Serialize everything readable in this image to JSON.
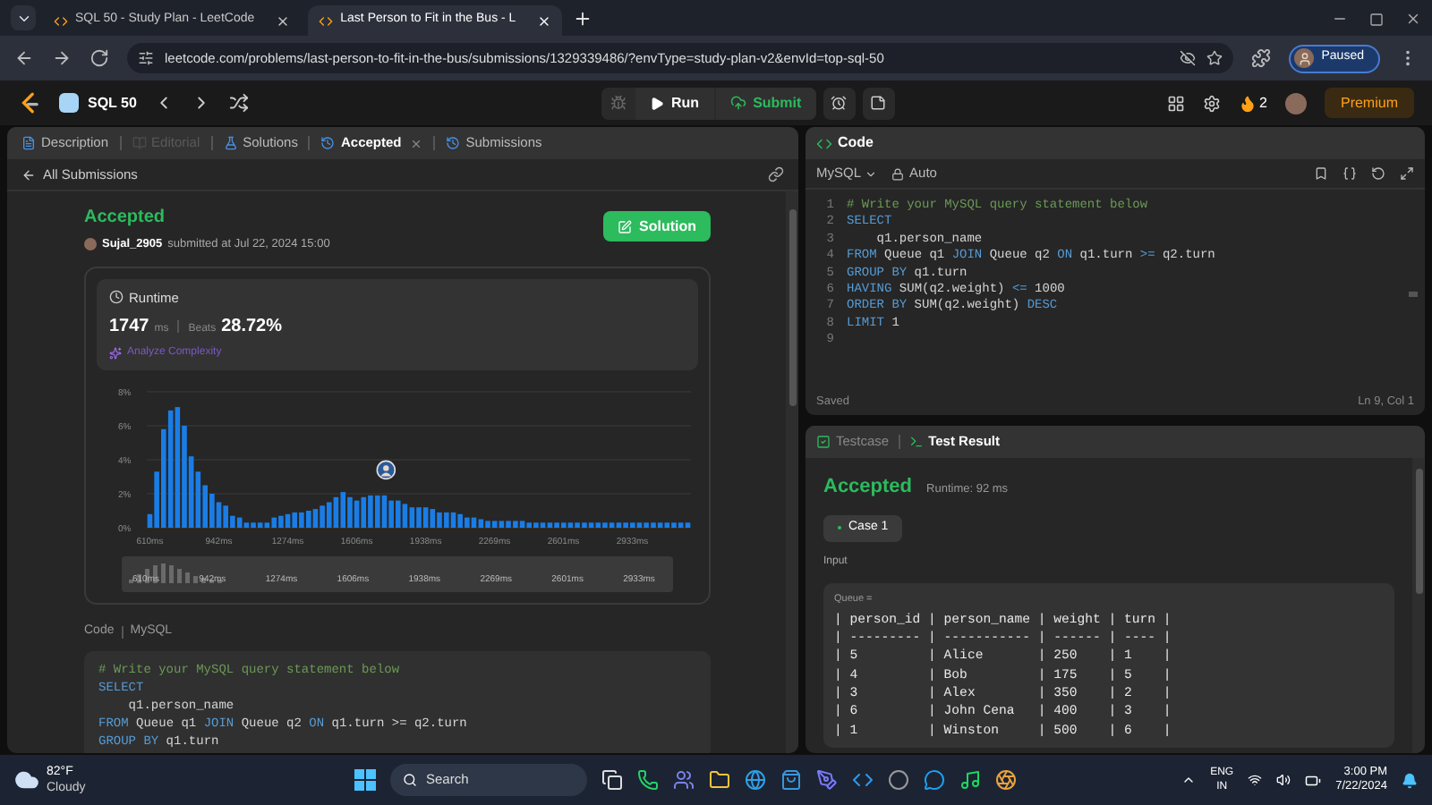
{
  "browser": {
    "tabs": [
      {
        "title": "SQL 50 - Study Plan - LeetCode",
        "selected": false
      },
      {
        "title": "Last Person to Fit in the Bus - L",
        "selected": true
      }
    ],
    "url": "leetcode.com/problems/last-person-to-fit-in-the-bus/submissions/1329339486/?envType=study-plan-v2&envId=top-sql-50",
    "profile": "Paused"
  },
  "nav": {
    "study_plan": "SQL 50",
    "run": "Run",
    "submit": "Submit",
    "streak": "2",
    "premium": "Premium"
  },
  "left_tabs": [
    {
      "label": "Description",
      "selected": false,
      "disabled": false,
      "closable": false
    },
    {
      "label": "Editorial",
      "selected": false,
      "disabled": true,
      "closable": false
    },
    {
      "label": "Solutions",
      "selected": false,
      "disabled": false,
      "closable": false
    },
    {
      "label": "Accepted",
      "selected": true,
      "disabled": false,
      "closable": true
    },
    {
      "label": "Submissions",
      "selected": false,
      "disabled": false,
      "closable": false
    }
  ],
  "back_link": "All Submissions",
  "submission": {
    "status": "Accepted",
    "user": "Sujal_2905",
    "submitted": "submitted at Jul 22, 2024 15:00",
    "solution_button": "Solution",
    "runtime_label": "Runtime",
    "runtime": "1747",
    "runtime_unit": "ms",
    "beats_label": "Beats",
    "beats": "28.72%",
    "analyze": "Analyze Complexity",
    "chart_data": {
      "type": "bar",
      "grid": true,
      "xlim": [
        595,
        3215
      ],
      "ylim": [
        0,
        8
      ],
      "x": [
        610,
        643,
        676,
        710,
        743,
        776,
        809,
        842,
        876,
        909,
        942,
        975,
        1008,
        1042,
        1075,
        1108,
        1141,
        1174,
        1208,
        1241,
        1274,
        1307,
        1340,
        1374,
        1407,
        1440,
        1473,
        1506,
        1540,
        1573,
        1606,
        1639,
        1672,
        1706,
        1739,
        1772,
        1805,
        1838,
        1872,
        1905,
        1938,
        1971,
        2004,
        2038,
        2071,
        2104,
        2137,
        2170,
        2204,
        2237,
        2270,
        2303,
        2336,
        2370,
        2403,
        2436,
        2469,
        2502,
        2536,
        2569,
        2602,
        2635,
        2668,
        2702,
        2735,
        2768,
        2801,
        2834,
        2868,
        2901,
        2934,
        2967,
        3000,
        3034,
        3067,
        3100,
        3133,
        3166,
        3200
      ],
      "values": [
        0.8,
        3.3,
        5.8,
        6.9,
        7.1,
        6.0,
        4.2,
        3.3,
        2.5,
        2.0,
        1.5,
        1.3,
        0.7,
        0.6,
        0.3,
        0.3,
        0.3,
        0.3,
        0.6,
        0.7,
        0.8,
        0.9,
        0.9,
        1.0,
        1.1,
        1.3,
        1.5,
        1.8,
        2.1,
        1.8,
        1.6,
        1.8,
        1.9,
        1.9,
        1.9,
        1.6,
        1.6,
        1.4,
        1.2,
        1.2,
        1.2,
        1.1,
        0.9,
        0.9,
        0.9,
        0.8,
        0.6,
        0.6,
        0.5,
        0.4,
        0.4,
        0.4,
        0.4,
        0.4,
        0.4,
        0.3,
        0.3,
        0.3,
        0.3,
        0.3,
        0.3,
        0.3,
        0.3,
        0.3,
        0.3,
        0.3,
        0.3,
        0.3,
        0.3,
        0.3,
        0.3,
        0.3,
        0.3,
        0.3,
        0.3,
        0.3,
        0.3,
        0.3,
        0.3
      ],
      "xticks": [
        {
          "value": 610,
          "label": "610ms"
        },
        {
          "value": 942,
          "label": "942ms"
        },
        {
          "value": 1274,
          "label": "1274ms"
        },
        {
          "value": 1606,
          "label": "1606ms"
        },
        {
          "value": 1938,
          "label": "1938ms"
        },
        {
          "value": 2269,
          "label": "2269ms"
        },
        {
          "value": 2601,
          "label": "2601ms"
        },
        {
          "value": 2933,
          "label": "2933ms"
        }
      ],
      "yticks": [
        {
          "value": 0,
          "label": "0%"
        },
        {
          "value": 2,
          "label": "2%"
        },
        {
          "value": 4,
          "label": "4%"
        },
        {
          "value": 6,
          "label": "6%"
        },
        {
          "value": 8,
          "label": "8%"
        }
      ]
    },
    "overview_labels": [
      "610ms",
      "942ms",
      "1274ms",
      "1606ms",
      "1938ms",
      "2269ms",
      "2601ms",
      "2933ms"
    ]
  },
  "code_section": {
    "label": "Code",
    "language": "MySQL",
    "lines": [
      {
        "tokens": [
          {
            "text": "# Write your MySQL query statement below",
            "kind": "comment"
          }
        ]
      },
      {
        "tokens": [
          {
            "text": "SELECT",
            "kind": "keyword"
          }
        ]
      },
      {
        "tokens": [
          {
            "text": "    q1.person_name",
            "kind": "plain"
          }
        ]
      },
      {
        "tokens": [
          {
            "text": "FROM",
            "kind": "keyword"
          },
          {
            "text": " Queue q1 ",
            "kind": "plain"
          },
          {
            "text": "JOIN",
            "kind": "keyword"
          },
          {
            "text": " Queue q2 ",
            "kind": "plain"
          },
          {
            "text": "ON",
            "kind": "keyword"
          },
          {
            "text": " q1.turn >= q2.turn",
            "kind": "plain"
          }
        ]
      },
      {
        "tokens": [
          {
            "text": "GROUP BY",
            "kind": "keyword"
          },
          {
            "text": " q1.turn",
            "kind": "plain"
          }
        ]
      }
    ]
  },
  "editor": {
    "title": "Code",
    "language": "MySQL",
    "mode": "Auto",
    "lines": [
      {
        "number": "1",
        "tokens": [
          {
            "text": "# Write your MySQL query statement below",
            "kind": "comment"
          }
        ]
      },
      {
        "number": "2",
        "tokens": [
          {
            "text": "SELECT",
            "kind": "keyword"
          }
        ]
      },
      {
        "number": "3",
        "tokens": [
          {
            "text": "    q1.person_name",
            "kind": "plain"
          }
        ]
      },
      {
        "number": "4",
        "tokens": [
          {
            "text": "FROM",
            "kind": "keyword"
          },
          {
            "text": " Queue q1 ",
            "kind": "plain"
          },
          {
            "text": "JOIN",
            "kind": "keyword"
          },
          {
            "text": " Queue q2 ",
            "kind": "plain"
          },
          {
            "text": "ON",
            "kind": "keyword"
          },
          {
            "text": " q1.turn ",
            "kind": "plain"
          },
          {
            "text": ">=",
            "kind": "keyword"
          },
          {
            "text": " q2.turn",
            "kind": "plain"
          }
        ]
      },
      {
        "number": "5",
        "tokens": [
          {
            "text": "GROUP BY",
            "kind": "keyword"
          },
          {
            "text": " q1.turn",
            "kind": "plain"
          }
        ]
      },
      {
        "number": "6",
        "tokens": [
          {
            "text": "HAVING",
            "kind": "keyword"
          },
          {
            "text": " SUM(q2.weight) ",
            "kind": "plain"
          },
          {
            "text": "<=",
            "kind": "keyword"
          },
          {
            "text": " 1000",
            "kind": "plain"
          }
        ]
      },
      {
        "number": "7",
        "tokens": [
          {
            "text": "ORDER BY",
            "kind": "keyword"
          },
          {
            "text": " SUM(q2.weight) ",
            "kind": "plain"
          },
          {
            "text": "DESC",
            "kind": "keyword"
          }
        ]
      },
      {
        "number": "8",
        "tokens": [
          {
            "text": "LIMIT",
            "kind": "keyword"
          },
          {
            "text": " 1",
            "kind": "plain"
          }
        ]
      },
      {
        "number": "9"
      }
    ],
    "status": "Saved",
    "cursor": "Ln 9, Col 1"
  },
  "test_panel": {
    "tabs": [
      {
        "label": "Testcase",
        "selected": false
      },
      {
        "label": "Test Result",
        "selected": true
      }
    ],
    "status": "Accepted",
    "runtime": "Runtime: 92 ms",
    "cases": [
      {
        "label": "Case 1",
        "selected": true
      }
    ],
    "input_label": "Input",
    "param": "Queue =",
    "table_lines": [
      "| person_id | person_name | weight | turn |",
      "| --------- | ----------- | ------ | ---- |",
      "| 5         | Alice       | 250    | 1    |",
      "| 4         | Bob         | 175    | 5    |",
      "| 3         | Alex        | 350    | 2    |",
      "| 6         | John Cena   | 400    | 3    |",
      "| 1         | Winston     | 500    | 6    |"
    ]
  },
  "taskbar": {
    "temperature": "82°F",
    "weather": "Cloudy",
    "search": "Search",
    "language": "ENG",
    "region": "IN",
    "time": "3:00 PM",
    "date": "7/22/2024"
  }
}
